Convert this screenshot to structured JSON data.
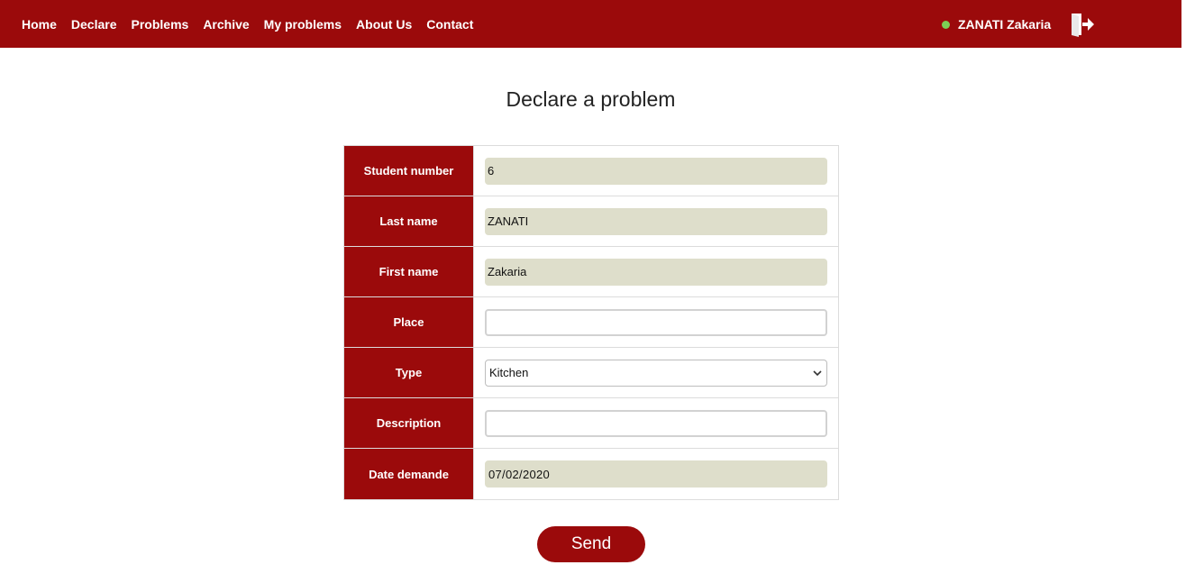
{
  "nav": {
    "items": [
      {
        "label": "Home"
      },
      {
        "label": "Declare"
      },
      {
        "label": "Problems"
      },
      {
        "label": "Archive"
      },
      {
        "label": "My problems"
      },
      {
        "label": "About Us"
      },
      {
        "label": "Contact"
      }
    ]
  },
  "user": {
    "name": "ZANATI Zakaria",
    "status_color": "#7ccf55"
  },
  "page": {
    "title": "Declare a problem"
  },
  "form": {
    "student_number": {
      "label": "Student number",
      "value": "6"
    },
    "last_name": {
      "label": "Last name",
      "value": "ZANATI"
    },
    "first_name": {
      "label": "First name",
      "value": "Zakaria"
    },
    "place": {
      "label": "Place",
      "value": ""
    },
    "type": {
      "label": "Type",
      "value": "Kitchen"
    },
    "description": {
      "label": "Description",
      "value": ""
    },
    "date_demande": {
      "label": "Date demande",
      "value": "07/02/2020"
    }
  },
  "actions": {
    "send_label": "Send"
  },
  "colors": {
    "brand": "#9b0a0b",
    "readonly_field": "#dedecb"
  }
}
